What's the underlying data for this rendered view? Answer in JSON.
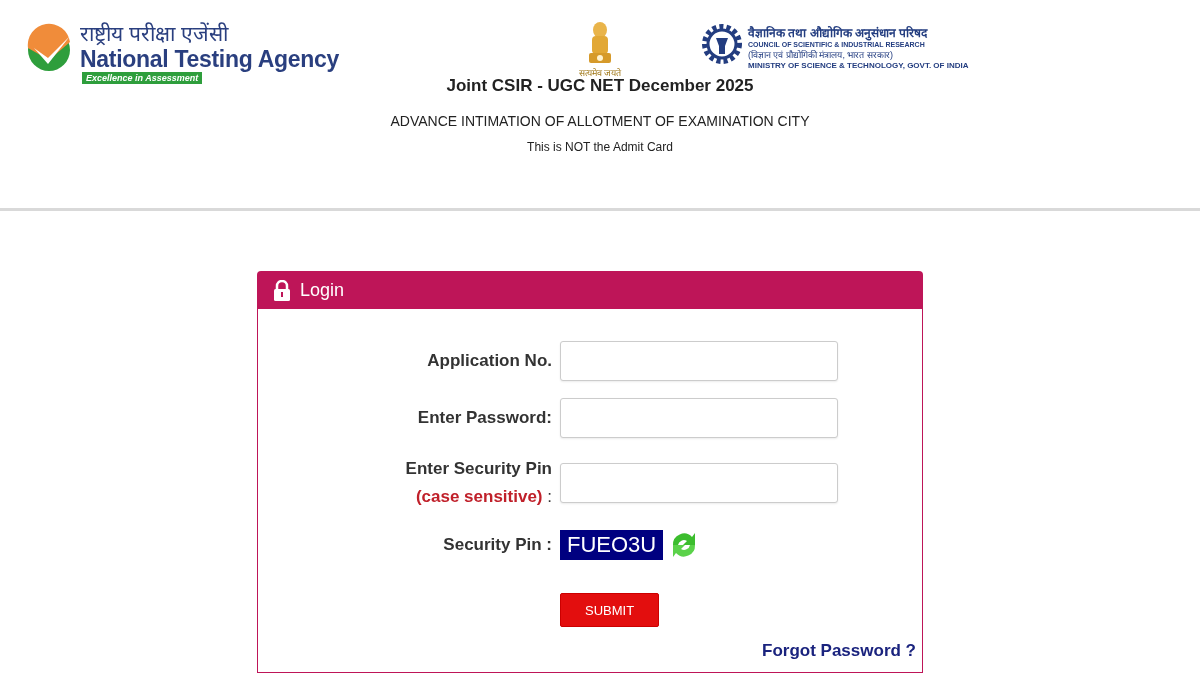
{
  "header": {
    "left_logo": {
      "hindi": "राष्ट्रीय परीक्षा एजेंसी",
      "name": "National Testing Agency",
      "tagline": "Excellence in Assessment"
    },
    "emblem": {
      "motto": "सत्यमेव जयते"
    },
    "right_logo": {
      "hindi": "वैज्ञानिक तथा औद्योगिक अनुसंधान परिषद",
      "name": "COUNCIL OF SCIENTIFIC & INDUSTRIAL RESEARCH",
      "ministry_hindi": "(विज्ञान एवं प्रौद्योगिकी मंत्रालय, भारत सरकार)",
      "ministry": "MINISTRY OF SCIENCE & TECHNOLOGY, GOVT. OF INDIA"
    },
    "title": "Joint CSIR - UGC NET December 2025",
    "subtitle": "ADVANCE INTIMATION OF ALLOTMENT OF EXAMINATION CITY",
    "note": "This is NOT the Admit Card"
  },
  "login": {
    "title": "Login",
    "fields": [
      {
        "kind": "input",
        "label": "Application No."
      },
      {
        "kind": "input",
        "label": "Enter Password:"
      },
      {
        "kind": "input",
        "label": "Enter Security Pin",
        "hint": "(case sensitive)",
        "suffix": ":"
      },
      {
        "kind": "captcha",
        "label": "Security Pin :",
        "code": "FUEO3U"
      }
    ],
    "submit": "SUBMIT",
    "forgot": "Forgot Password ?"
  }
}
